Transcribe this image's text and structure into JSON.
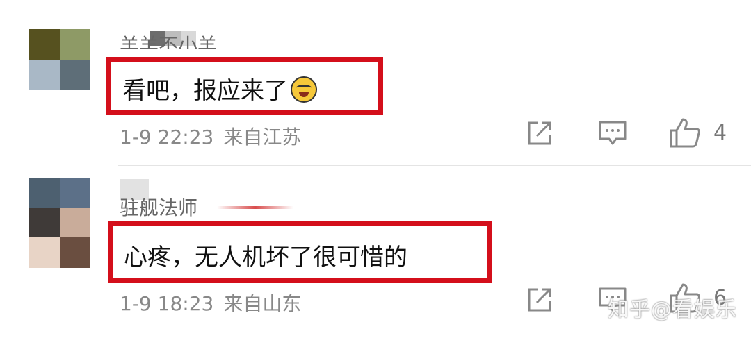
{
  "comments": [
    {
      "username": "羊羊不小羊",
      "text": "看吧，报应来了",
      "emoji": "laughing-crying-emoji",
      "date": "1-9 22:23",
      "location": "来自江苏",
      "likes": "4"
    },
    {
      "username": "驻舰法师",
      "text": "心疼，无人机坏了很可惜的",
      "date": "1-9 18:23",
      "location": "来自山东",
      "likes": "6"
    }
  ],
  "watermark": "知乎@看娱乐",
  "colors": {
    "highlight": "#d40f1b",
    "meta": "#888888"
  }
}
